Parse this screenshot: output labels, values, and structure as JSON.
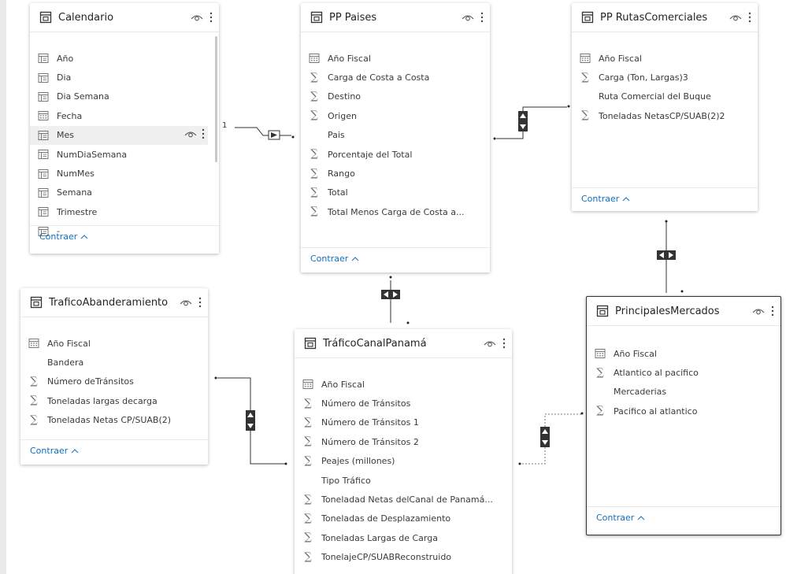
{
  "tables": {
    "calendario": {
      "title": "Calendario",
      "fields": [
        {
          "label": "Año",
          "icon": "hierarchy-icon"
        },
        {
          "label": "Dia",
          "icon": "hierarchy-icon"
        },
        {
          "label": "Dia Semana",
          "icon": "hierarchy-icon"
        },
        {
          "label": "Fecha",
          "icon": "calendar-icon"
        },
        {
          "label": "Mes",
          "icon": "hierarchy-icon"
        },
        {
          "label": "NumDiaSemana",
          "icon": "hierarchy-icon"
        },
        {
          "label": "NumMes",
          "icon": "hierarchy-icon"
        },
        {
          "label": "Semana",
          "icon": "hierarchy-icon"
        },
        {
          "label": "Trimestre",
          "icon": "hierarchy-icon"
        },
        {
          "label": "-",
          "icon": "hierarchy-icon"
        }
      ],
      "collapse": "Contraer"
    },
    "pp_paises": {
      "title": "PP Paises",
      "fields": [
        {
          "label": "Año Fiscal",
          "icon": "calendar-icon"
        },
        {
          "label": "Carga de Costa a Costa",
          "icon": "sigma-icon"
        },
        {
          "label": "Destino",
          "icon": "sigma-icon"
        },
        {
          "label": "Origen",
          "icon": "sigma-icon"
        },
        {
          "label": "Pais",
          "icon": "none"
        },
        {
          "label": "Porcentaje del Total",
          "icon": "sigma-icon"
        },
        {
          "label": "Rango",
          "icon": "sigma-icon"
        },
        {
          "label": "Total",
          "icon": "sigma-icon"
        },
        {
          "label": "Total Menos Carga de Costa a...",
          "icon": "sigma-icon"
        }
      ],
      "collapse": "Contraer"
    },
    "pp_rutas": {
      "title": "PP RutasComerciales",
      "fields": [
        {
          "label": "Año Fiscal",
          "icon": "calendar-icon"
        },
        {
          "label": "Carga (Ton, Largas)3",
          "icon": "sigma-icon"
        },
        {
          "label": "Ruta Comercial del Buque",
          "icon": "none"
        },
        {
          "label": "Toneladas NetasCP/SUAB(2)2",
          "icon": "sigma-icon"
        }
      ],
      "collapse": "Contraer"
    },
    "trafico_abanderamiento": {
      "title": "TraficoAbanderamiento",
      "fields": [
        {
          "label": "Año Fiscal",
          "icon": "calendar-icon"
        },
        {
          "label": "Bandera",
          "icon": "none"
        },
        {
          "label": "Número deTránsitos",
          "icon": "sigma-icon"
        },
        {
          "label": "Toneladas largas decarga",
          "icon": "sigma-icon"
        },
        {
          "label": "Toneladas Netas CP/SUAB(2)",
          "icon": "sigma-icon"
        }
      ],
      "collapse": "Contraer"
    },
    "trafico_canal": {
      "title": "TráficoCanalPanamá",
      "fields": [
        {
          "label": "Año Fiscal",
          "icon": "calendar-icon"
        },
        {
          "label": "Número de Tránsitos",
          "icon": "sigma-icon"
        },
        {
          "label": "Número de Tránsitos 1",
          "icon": "sigma-icon"
        },
        {
          "label": "Número de Tránsitos 2",
          "icon": "sigma-icon"
        },
        {
          "label": "Peajes (millones)",
          "icon": "sigma-icon"
        },
        {
          "label": "Tipo Tráfico",
          "icon": "none"
        },
        {
          "label": "Toneladad Netas delCanal de Panamá...",
          "icon": "sigma-icon"
        },
        {
          "label": "Toneladas de Desplazamiento",
          "icon": "sigma-icon"
        },
        {
          "label": "Toneladas Largas de Carga",
          "icon": "sigma-icon"
        },
        {
          "label": "TonelajeCP/SUABReconstruido",
          "icon": "sigma-icon"
        }
      ]
    },
    "principales_mercados": {
      "title": "PrincipalesMercados",
      "fields": [
        {
          "label": "Año Fiscal",
          "icon": "calendar-icon"
        },
        {
          "label": "Atlantico al pacifico",
          "icon": "sigma-icon"
        },
        {
          "label": "Mercaderias",
          "icon": "none"
        },
        {
          "label": "Pacifico al atlantico",
          "icon": "sigma-icon"
        }
      ],
      "collapse": "Contraer"
    }
  },
  "relationships": {
    "calendario_paises_cardinality": "1"
  },
  "colors": {
    "link": "#106ebe",
    "line": "#333333",
    "selected_border": "#333333"
  }
}
